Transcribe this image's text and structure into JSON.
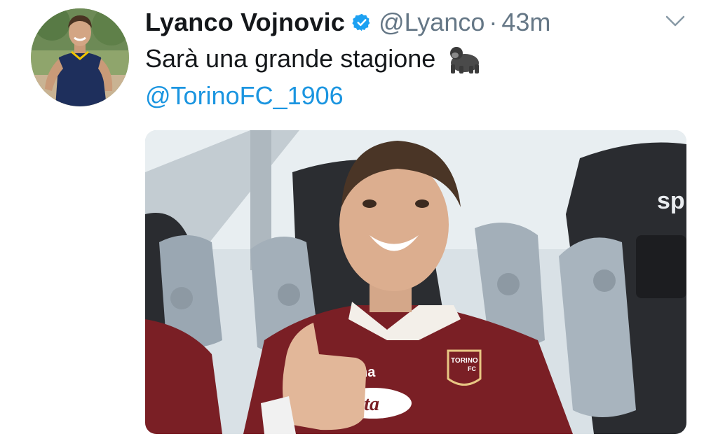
{
  "tweet": {
    "author_name": "Lyanco Vojnovic",
    "handle": "@Lyanco",
    "separator": "·",
    "time": "43m",
    "text_line1": "Sarà una grande stagione",
    "mention": "@TorinoFC_1906",
    "emoji": "gorilla-emoji",
    "verified": true
  },
  "media": {
    "description_icon": "photo",
    "shirt_texts": {
      "crest": "TORINO",
      "crest_fc": "FC",
      "sponsor_left": "na",
      "sponsor_main": "etta",
      "seat_brand": "sp"
    }
  },
  "colors": {
    "link": "#1b95e0",
    "verified": "#1da1f2",
    "text": "#14171a",
    "meta": "#657786",
    "jersey": "#7a1f25"
  }
}
